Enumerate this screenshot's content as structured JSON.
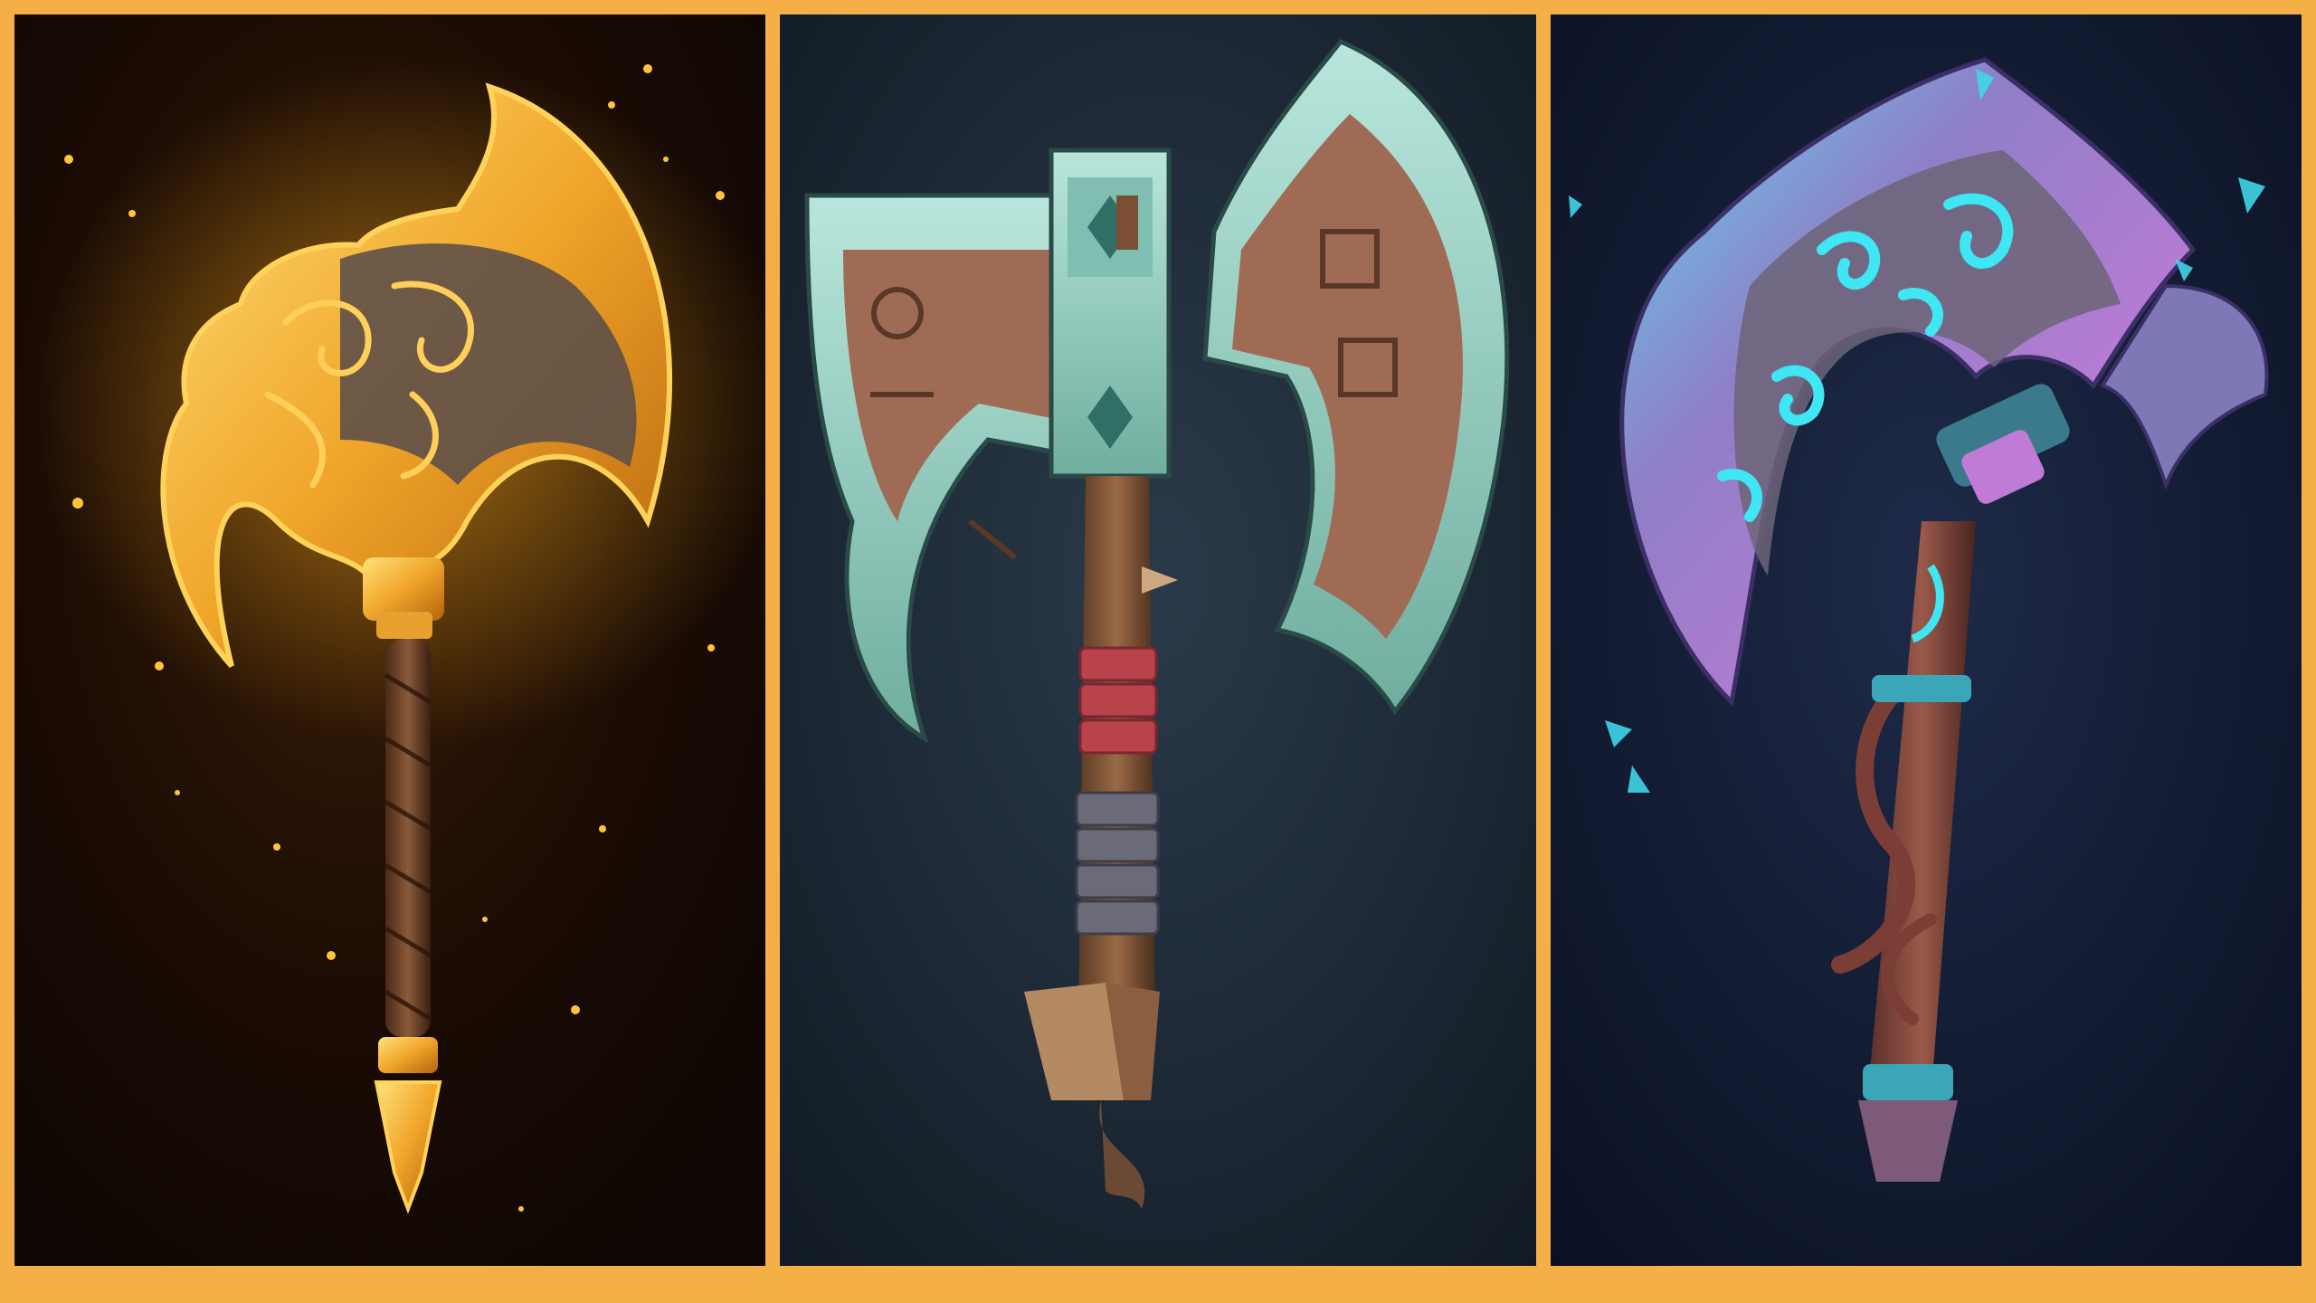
{
  "colors": {
    "frame_border": "#f4b046",
    "golden_bg_inner": "#3a1d06",
    "golden_bg_outer": "#0d0603",
    "golden_glow": "#ffb21e",
    "golden_metal": "#f0a52a",
    "teal_bg_inner": "#2b3a4a",
    "teal_bg_outer": "#111a24",
    "teal_metal": "#8fc9bf",
    "copper": "#a06b55",
    "arcane_bg_inner": "#1e2a48",
    "arcane_bg_outer": "#0a1022",
    "arcane_purple": "#a78bd6",
    "arcane_cyan": "#3fe6f4"
  },
  "panels": [
    {
      "id": "golden-axe",
      "icon": "golden-battle-axe",
      "theme": "fire-gold"
    },
    {
      "id": "teal-axe",
      "icon": "double-bladed-stone-axe",
      "theme": "teal-copper"
    },
    {
      "id": "arcane-axe",
      "icon": "arcane-crescent-axe",
      "theme": "neon-purple-cyan"
    }
  ]
}
